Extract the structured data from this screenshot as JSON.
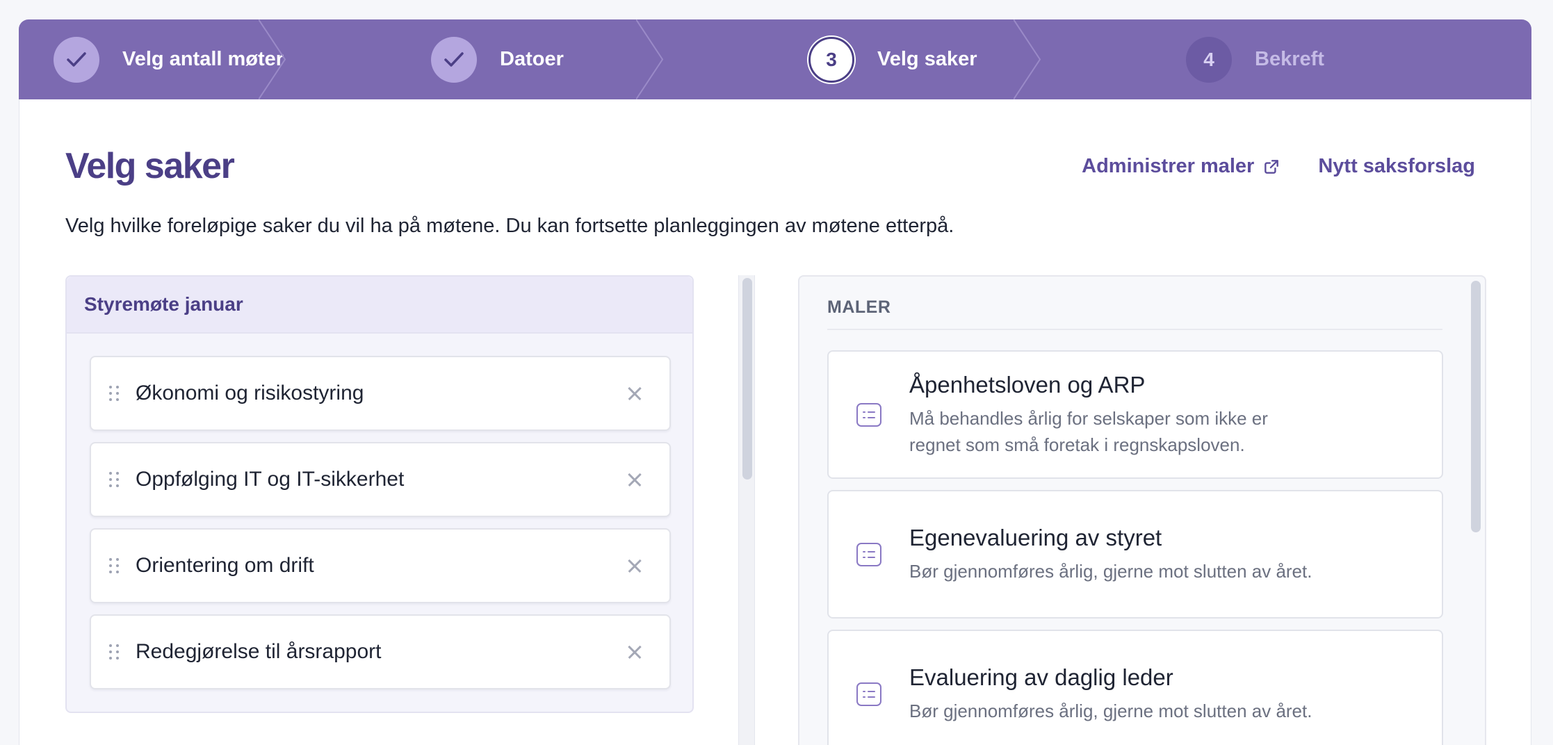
{
  "stepper": {
    "steps": [
      {
        "number": "",
        "label": "Velg antall møter",
        "state": "done"
      },
      {
        "number": "",
        "label": "Datoer",
        "state": "done"
      },
      {
        "number": "3",
        "label": "Velg saker",
        "state": "current"
      },
      {
        "number": "4",
        "label": "Bekreft",
        "state": "upcoming"
      }
    ]
  },
  "page": {
    "title": "Velg saker",
    "subtitle": "Velg hvilke foreløpige saker du vil ha på møtene. Du kan fortsette planleggingen av møtene etterpå.",
    "links": {
      "manage_templates": "Administrer maler",
      "new_proposal": "Nytt saksforslag"
    }
  },
  "meeting": {
    "title": "Styremøte januar",
    "items": [
      {
        "label": "Økonomi og risikostyring"
      },
      {
        "label": "Oppfølging IT og IT-sikkerhet"
      },
      {
        "label": "Orientering om drift"
      },
      {
        "label": "Redegjørelse til årsrapport"
      }
    ]
  },
  "templates": {
    "heading": "MALER",
    "items": [
      {
        "title": "Åpenhetsloven og ARP",
        "description": "Må behandles årlig for selskaper som ikke er regnet som små foretak i regnskapsloven."
      },
      {
        "title": "Egenevaluering av styret",
        "description": "Bør gjennomføres årlig, gjerne mot slutten av året."
      },
      {
        "title": "Evaluering av daglig leder",
        "description": "Bør gjennomføres årlig, gjerne mot slutten av året."
      }
    ]
  },
  "colors": {
    "brand": "#7c6ab1",
    "brand_dark": "#4b3f86",
    "link": "#5c4d9c"
  }
}
